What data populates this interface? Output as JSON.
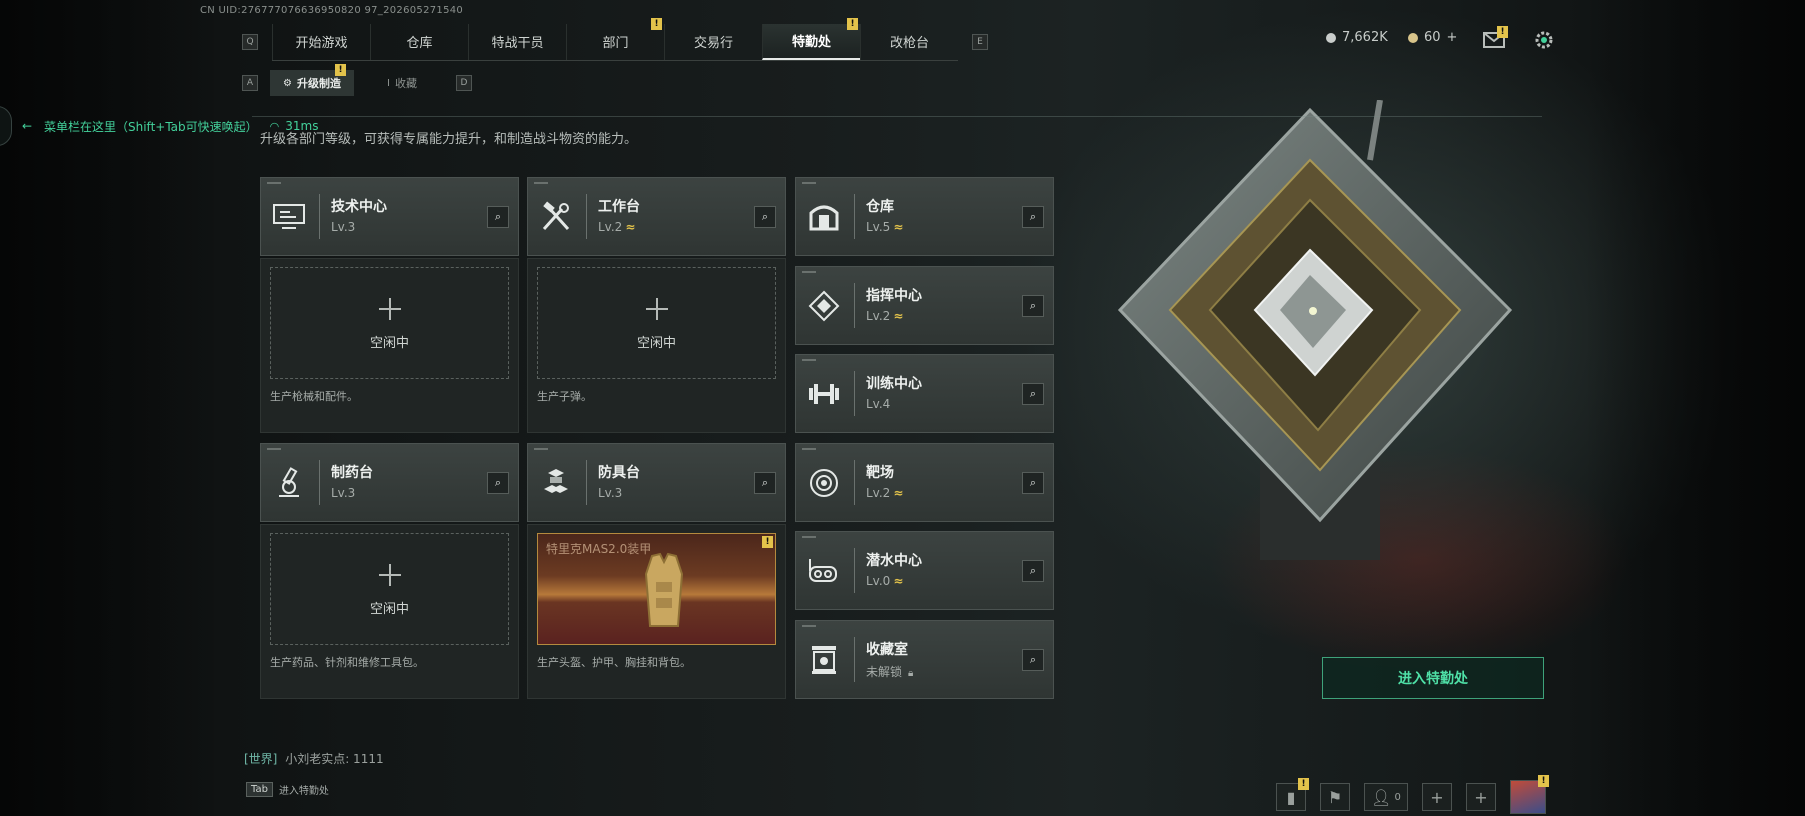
{
  "uid_text": "CN UID:276777076636950820 97_202605271540",
  "top_nav": {
    "left_key": "Q",
    "right_key": "E",
    "tabs": [
      {
        "label": "开始游戏",
        "badge": ""
      },
      {
        "label": "仓库",
        "badge": ""
      },
      {
        "label": "特战干员",
        "badge": ""
      },
      {
        "label": "部门",
        "badge": "!"
      },
      {
        "label": "交易行",
        "badge": ""
      },
      {
        "label": "特勤处",
        "badge": "!",
        "active": true
      },
      {
        "label": "改枪台",
        "badge": ""
      }
    ]
  },
  "sub_nav": {
    "left_key": "A",
    "right_key": "D",
    "tabs": [
      {
        "label": "升级制造",
        "badge": "!",
        "active": true
      },
      {
        "label": "收藏",
        "badge": ""
      }
    ]
  },
  "menu_hint": {
    "text": "菜单栏在这里（Shift+Tab可快速唤起）",
    "ping": "31ms"
  },
  "description": "升级各部门等级，可获得专属能力提升，和制造战斗物资的能力。",
  "stations": {
    "tech": {
      "name": "技术中心",
      "level": "Lv.3",
      "upgradeable": false,
      "icon": "monitor-icon"
    },
    "workbench": {
      "name": "工作台",
      "level": "Lv.2",
      "upgradeable": true,
      "icon": "tools-icon"
    },
    "pharmacy": {
      "name": "制药台",
      "level": "Lv.3",
      "upgradeable": false,
      "icon": "microscope-icon"
    },
    "armor": {
      "name": "防具台",
      "level": "Lv.3",
      "upgradeable": false,
      "icon": "cubes-icon"
    },
    "warehouse": {
      "name": "仓库",
      "level": "Lv.5",
      "upgradeable": true,
      "icon": "warehouse-icon"
    },
    "command": {
      "name": "指挥中心",
      "level": "Lv.2",
      "upgradeable": true,
      "icon": "command-icon"
    },
    "training": {
      "name": "训练中心",
      "level": "Lv.4",
      "upgradeable": false,
      "icon": "dumbbell-icon"
    },
    "range": {
      "name": "靶场",
      "level": "Lv.2",
      "upgradeable": true,
      "icon": "target-icon"
    },
    "diving": {
      "name": "潜水中心",
      "level": "Lv.0",
      "upgradeable": true,
      "icon": "dive-mask-icon"
    },
    "collection": {
      "name": "收藏室",
      "level": "未解锁",
      "locked": true,
      "icon": "trophy-icon"
    }
  },
  "upgrade_glyph": "≈",
  "production": {
    "tech": {
      "status": "空闲中",
      "desc": "生产枪械和配件。"
    },
    "workbench": {
      "status": "空闲中",
      "desc": "生产子弹。"
    },
    "pharmacy": {
      "status": "空闲中",
      "desc": "生产药品、针剂和维修工具包。"
    },
    "armor": {
      "item": "特里克MAS2.0装甲",
      "badge": "!",
      "desc": "生产头盔、护甲、胸挂和背包。"
    }
  },
  "currency": {
    "coins": "7,662K",
    "tickets": "60",
    "ticket_add": "+"
  },
  "enter_button": "进入特勤处",
  "chat": {
    "channel": "[世界]",
    "message": "小刘老实点: 1111"
  },
  "tab_hint": {
    "key": "Tab",
    "label": "进入特勤处"
  },
  "bottom_bar": {
    "friends_count": "0"
  },
  "colors": {
    "accent_green": "#43d19b",
    "badge_yellow": "#e3c34b",
    "upgrade_yellow": "#e3c34b"
  }
}
